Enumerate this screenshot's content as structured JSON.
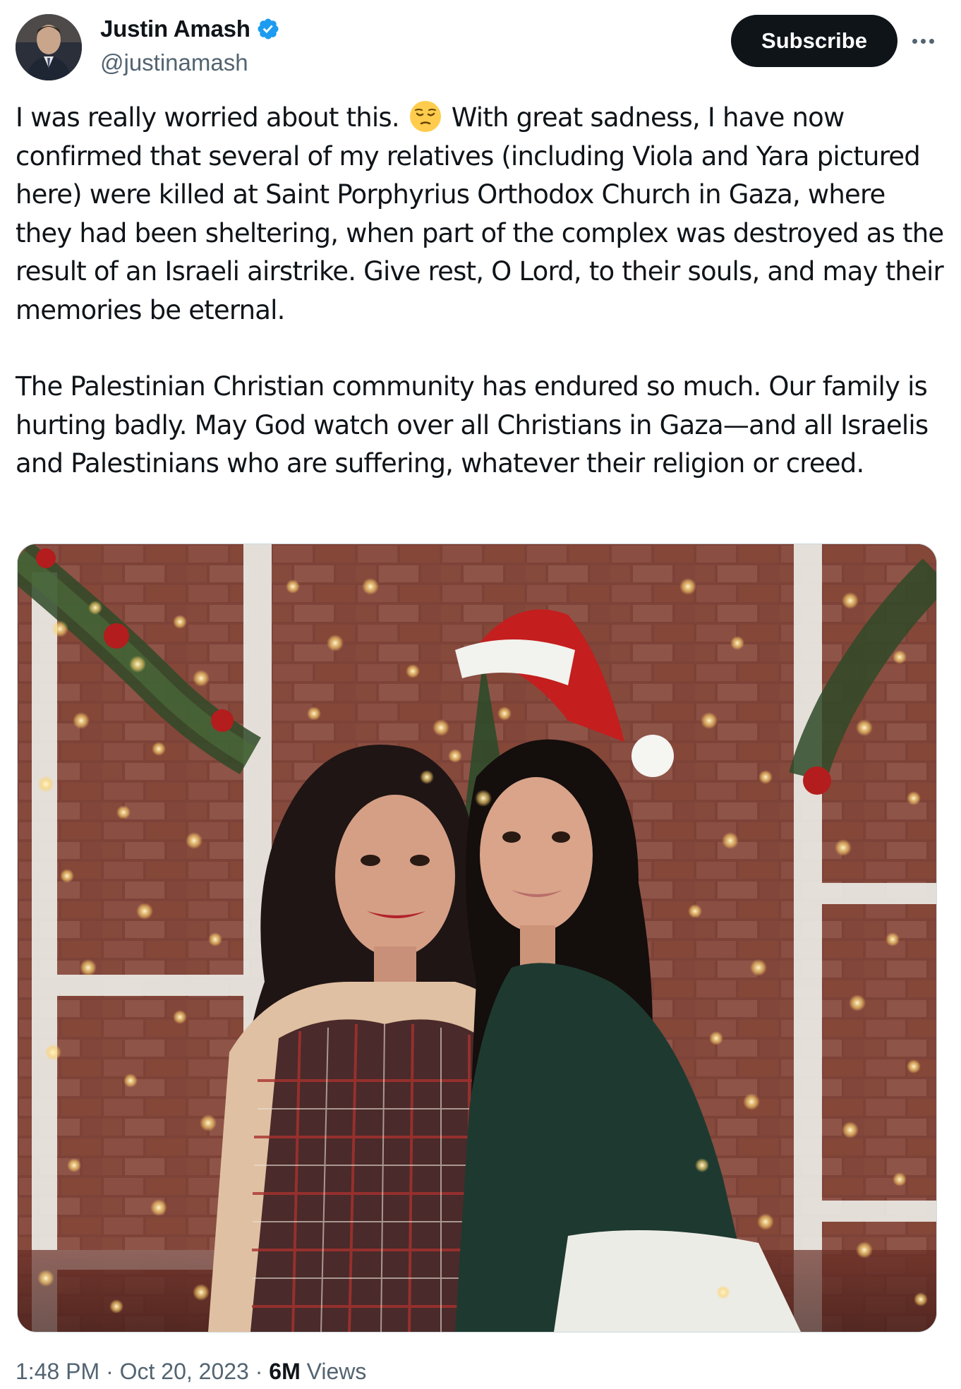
{
  "author": {
    "name": "Justin Amash",
    "handle": "@justinamash",
    "verified": true,
    "verified_color": "#1d9bf0"
  },
  "actions": {
    "subscribe_label": "Subscribe",
    "more_icon": "more-horizontal-icon"
  },
  "tweet": {
    "para1_before_emoji": "I was really worried about this.",
    "emoji": "pensive-face-emoji",
    "para1_after_emoji": "With great sadness, I have now confirmed that several of my relatives (including Viola and Yara pictured here) were killed at Saint Porphyrius Orthodox Church in Gaza, where they had been sheltering, when part of the complex was destroyed as the result of an Israeli airstrike. Give rest, O Lord, to their souls, and may their memories be eternal.",
    "para2": "The Palestinian Christian community has endured so much. Our family is hurting badly. May God watch over all Christians in Gaza—and all Israelis and Palestinians who are suffering, whatever their religion or creed."
  },
  "media": {
    "kind": "photo",
    "description_icon": "photo-of-two-women-christmas-backdrop"
  },
  "footer": {
    "time": "1:48 PM",
    "separator": "·",
    "date": "Oct 20, 2023",
    "views_count": "6M",
    "views_label": "Views"
  },
  "colors": {
    "text_primary": "#0f1419",
    "text_secondary": "#536471",
    "button_bg": "#0f1419",
    "button_text": "#ffffff",
    "verified": "#1d9bf0"
  }
}
